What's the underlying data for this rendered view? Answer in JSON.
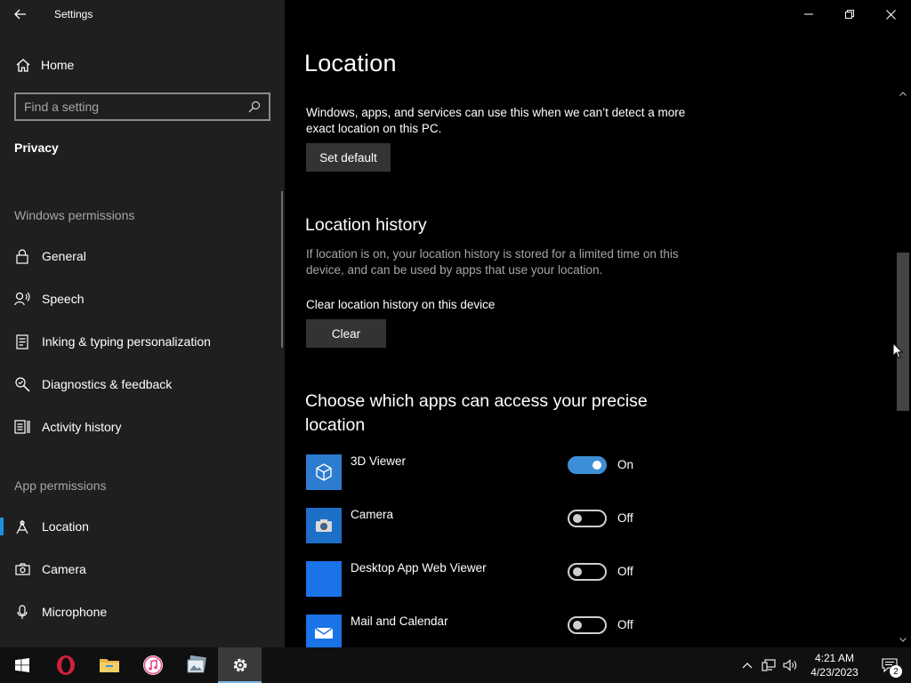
{
  "window": {
    "title": "Settings",
    "back_icon": "back-arrow-icon",
    "controls": [
      "minimize-icon",
      "restore-icon",
      "close-icon"
    ]
  },
  "sidebar": {
    "home_label": "Home",
    "search_placeholder": "Find a setting",
    "section": "Privacy",
    "windows_permissions": {
      "heading": "Windows permissions",
      "items": [
        {
          "label": "General",
          "icon": "lock-icon"
        },
        {
          "label": "Speech",
          "icon": "speech-icon"
        },
        {
          "label": "Inking & typing personalization",
          "icon": "inking-icon"
        },
        {
          "label": "Diagnostics & feedback",
          "icon": "diagnostics-icon"
        },
        {
          "label": "Activity history",
          "icon": "activity-history-icon"
        }
      ]
    },
    "app_permissions": {
      "heading": "App permissions",
      "items": [
        {
          "label": "Location",
          "icon": "location-icon",
          "active": true
        },
        {
          "label": "Camera",
          "icon": "camera-icon"
        },
        {
          "label": "Microphone",
          "icon": "microphone-icon"
        }
      ]
    }
  },
  "main": {
    "title": "Location",
    "default_location": {
      "description": "Windows, apps, and services can use this when we can’t detect a more exact location on this PC.",
      "button": "Set default"
    },
    "history": {
      "heading": "Location history",
      "description": "If location is on, your location history is stored for a limited time on this device, and can be used by apps that use your location.",
      "clear_label": "Clear location history on this device",
      "button": "Clear"
    },
    "apps": {
      "heading": "Choose which apps can access your precise location",
      "items": [
        {
          "name": "3D Viewer",
          "state": "On",
          "on": true,
          "icon": "3d-viewer-icon",
          "color": "#2d7cd0"
        },
        {
          "name": "Camera",
          "state": "Off",
          "on": false,
          "icon": "camera-app-icon",
          "color": "#1e6fc8"
        },
        {
          "name": "Desktop App Web Viewer",
          "state": "Off",
          "on": false,
          "icon": "web-viewer-icon",
          "color": "#1a73e8"
        },
        {
          "name": "Mail and Calendar",
          "state": "Off",
          "on": false,
          "icon": "mail-icon",
          "color": "#1a73e8"
        }
      ]
    }
  },
  "taskbar": {
    "apps": [
      "windows-start-icon",
      "opera-icon",
      "file-explorer-icon",
      "itunes-icon",
      "photos-icon",
      "settings-gear-icon"
    ],
    "time": "4:21 AM",
    "date": "4/23/2023",
    "notification_count": "2"
  },
  "colors": {
    "accent": "#3c8ed6",
    "sidebar_bg": "#1f1f1f",
    "content_bg": "#000000"
  }
}
